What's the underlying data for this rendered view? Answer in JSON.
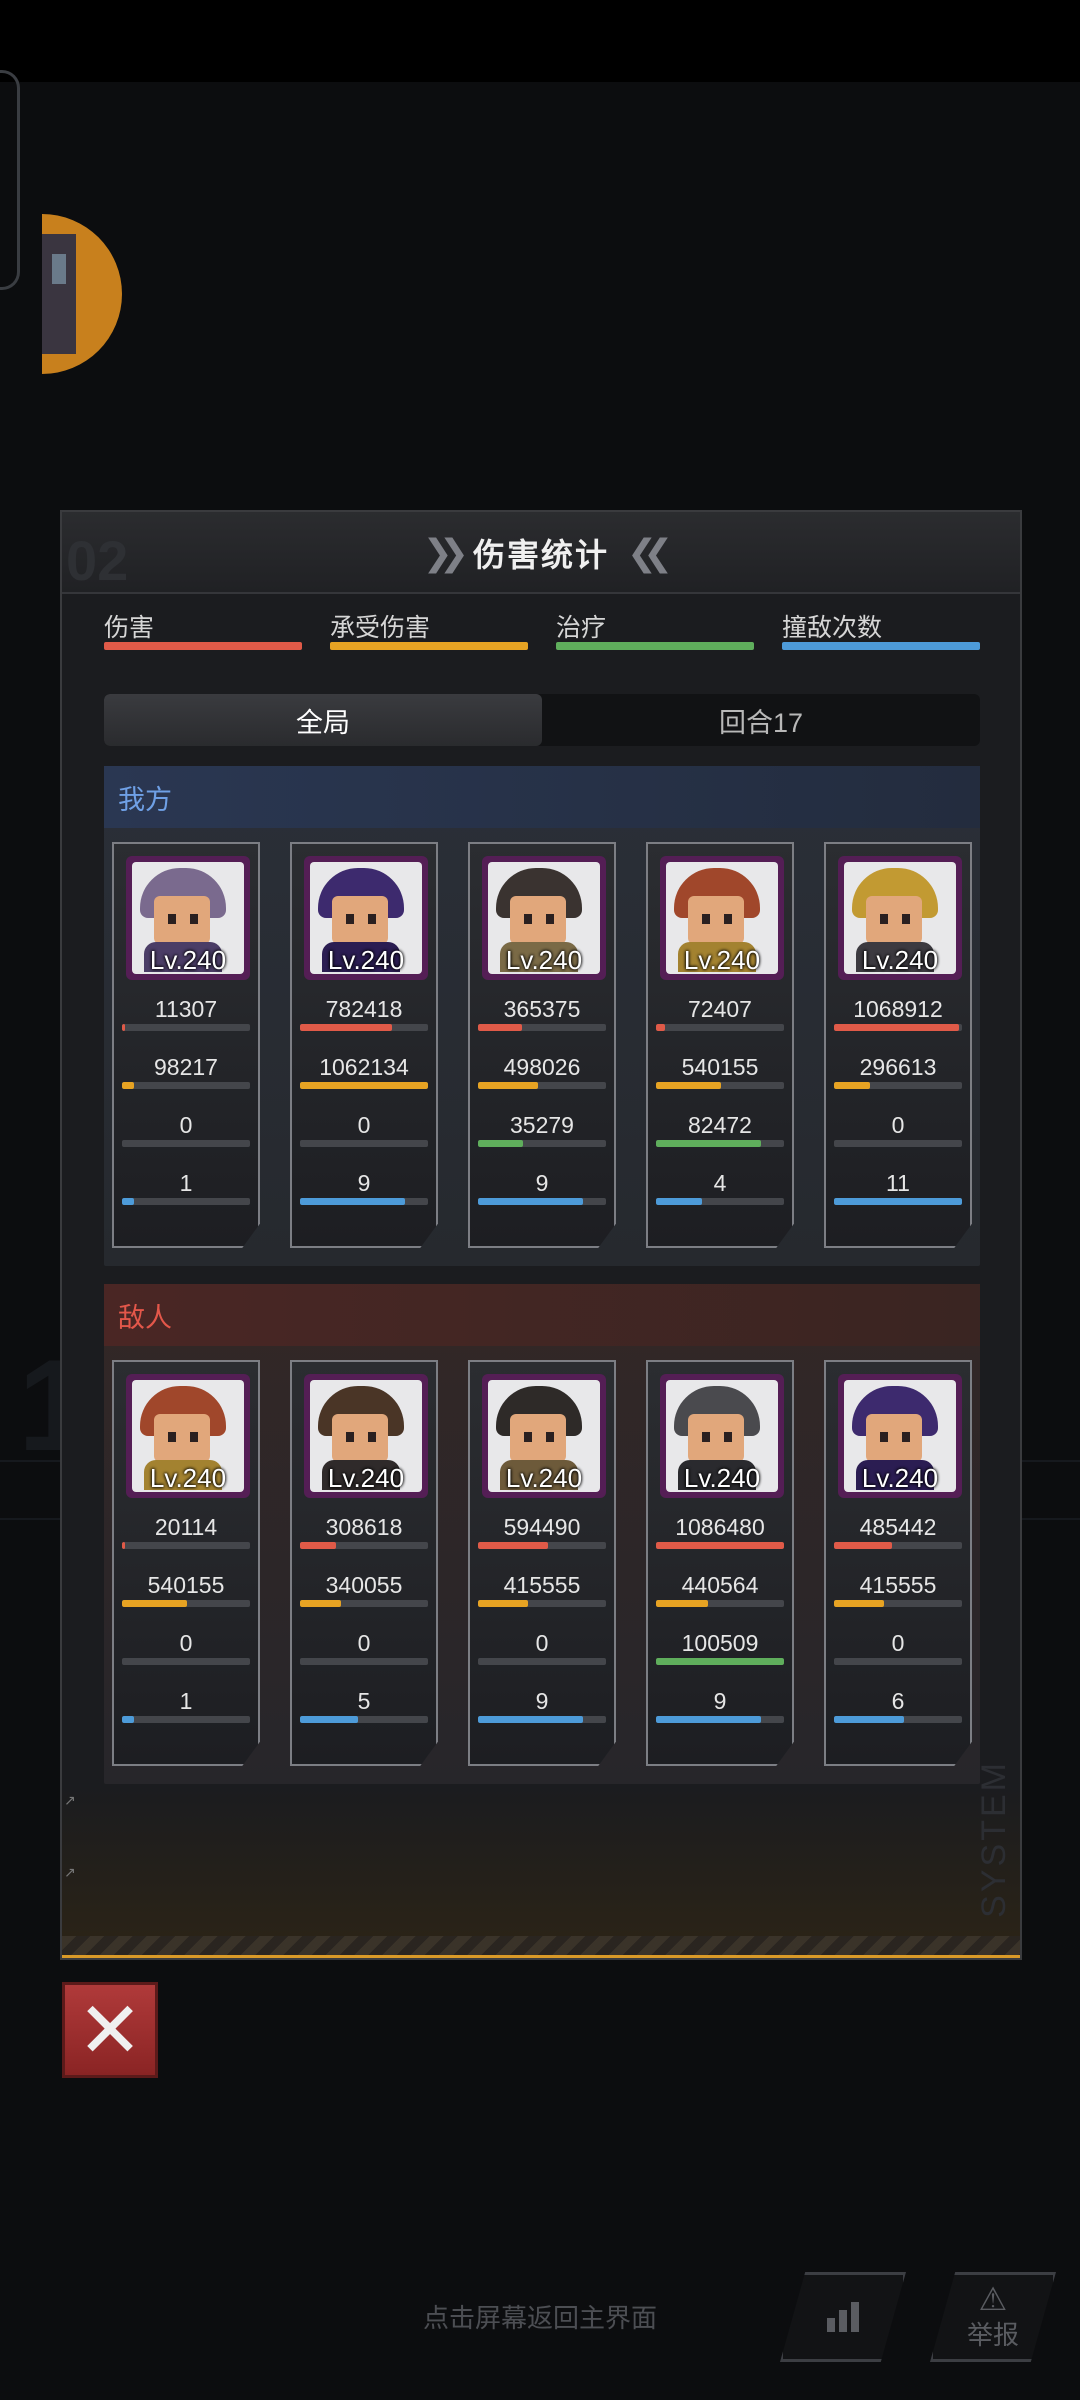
{
  "panel": {
    "title": "伤害统计",
    "ghost_number": "02",
    "system_label": "SYSTEM"
  },
  "legend": [
    {
      "label": "伤害",
      "color": "#e05a48"
    },
    {
      "label": "承受伤害",
      "color": "#e7a323"
    },
    {
      "label": "治疗",
      "color": "#5fae5c"
    },
    {
      "label": "撞敌次数",
      "color": "#4d9bd9"
    }
  ],
  "tabs": [
    {
      "label": "全局",
      "active": true
    },
    {
      "label": "回合17",
      "active": false
    }
  ],
  "ally": {
    "title": "我方",
    "units": [
      {
        "level": "Lv.240",
        "damage": "11307",
        "taken": "98217",
        "heal": "0",
        "hits": "1",
        "damage_pct": 0.02,
        "taken_pct": 0.09,
        "heal_pct": 0,
        "hits_pct": 0.09
      },
      {
        "level": "Lv.240",
        "damage": "782418",
        "taken": "1062134",
        "heal": "0",
        "hits": "9",
        "damage_pct": 0.72,
        "taken_pct": 1.0,
        "heal_pct": 0,
        "hits_pct": 0.82
      },
      {
        "level": "Lv.240",
        "damage": "365375",
        "taken": "498026",
        "heal": "35279",
        "hits": "9",
        "damage_pct": 0.34,
        "taken_pct": 0.47,
        "heal_pct": 0.35,
        "hits_pct": 0.82
      },
      {
        "level": "Lv.240",
        "damage": "72407",
        "taken": "540155",
        "heal": "82472",
        "hits": "4",
        "damage_pct": 0.07,
        "taken_pct": 0.51,
        "heal_pct": 0.82,
        "hits_pct": 0.36
      },
      {
        "level": "Lv.240",
        "damage": "1068912",
        "taken": "296613",
        "heal": "0",
        "hits": "11",
        "damage_pct": 0.98,
        "taken_pct": 0.28,
        "heal_pct": 0,
        "hits_pct": 1.0
      }
    ]
  },
  "enemy": {
    "title": "敌人",
    "units": [
      {
        "level": "Lv.240",
        "damage": "20114",
        "taken": "540155",
        "heal": "0",
        "hits": "1",
        "damage_pct": 0.02,
        "taken_pct": 0.51,
        "heal_pct": 0,
        "hits_pct": 0.09
      },
      {
        "level": "Lv.240",
        "damage": "308618",
        "taken": "340055",
        "heal": "0",
        "hits": "5",
        "damage_pct": 0.28,
        "taken_pct": 0.32,
        "heal_pct": 0,
        "hits_pct": 0.45
      },
      {
        "level": "Lv.240",
        "damage": "594490",
        "taken": "415555",
        "heal": "0",
        "hits": "9",
        "damage_pct": 0.55,
        "taken_pct": 0.39,
        "heal_pct": 0,
        "hits_pct": 0.82
      },
      {
        "level": "Lv.240",
        "damage": "1086480",
        "taken": "440564",
        "heal": "100509",
        "hits": "9",
        "damage_pct": 1.0,
        "taken_pct": 0.41,
        "heal_pct": 1.0,
        "hits_pct": 0.82
      },
      {
        "level": "Lv.240",
        "damage": "485442",
        "taken": "415555",
        "heal": "0",
        "hits": "6",
        "damage_pct": 0.45,
        "taken_pct": 0.39,
        "heal_pct": 0,
        "hits_pct": 0.55
      }
    ]
  },
  "portraits": {
    "ally": [
      {
        "hair": "#7a6a8e",
        "body": "#4b3d66"
      },
      {
        "hair": "#3d2a6e",
        "body": "#2b1d52"
      },
      {
        "hair": "#3a3330",
        "body": "#7a6a46"
      },
      {
        "hair": "#a0472b",
        "body": "#a38230"
      },
      {
        "hair": "#c29a32",
        "body": "#3c3a40"
      }
    ],
    "enemy": [
      {
        "hair": "#a0472b",
        "body": "#a38230"
      },
      {
        "hair": "#4a3526",
        "body": "#2f2a2a"
      },
      {
        "hair": "#2e2a28",
        "body": "#6d5a3a"
      },
      {
        "hair": "#4a4a4e",
        "body": "#2a2a2e"
      },
      {
        "hair": "#3d2a6e",
        "body": "#2b1d52"
      }
    ]
  },
  "footer": {
    "hint": "点击屏幕返回主界面",
    "report_label": "举报",
    "close_icon": "close-x-icon",
    "stats_icon": "bar-chart-icon",
    "report_icon": "warning-icon"
  }
}
